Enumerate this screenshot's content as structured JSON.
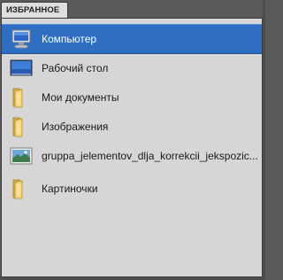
{
  "panel": {
    "tab_label": "ИЗБРАННОЕ",
    "items": [
      {
        "label": "Компьютер",
        "icon": "computer-icon",
        "selected": true
      },
      {
        "label": "Рабочий стол",
        "icon": "desktop-icon",
        "selected": false
      },
      {
        "label": "Мои документы",
        "icon": "folder-icon",
        "selected": false
      },
      {
        "label": "Изображения",
        "icon": "folder-icon",
        "selected": false
      },
      {
        "label": "gruppa_jelementov_dlja_korrekcii_jekspozic...",
        "icon": "image-file-icon",
        "selected": false
      },
      {
        "label": "Картиночки",
        "icon": "folder-icon",
        "selected": false
      }
    ]
  },
  "colors": {
    "selection": "#2e6fc4",
    "panel_bg": "#d6d6d6",
    "chrome_bg": "#5a5a5a"
  }
}
